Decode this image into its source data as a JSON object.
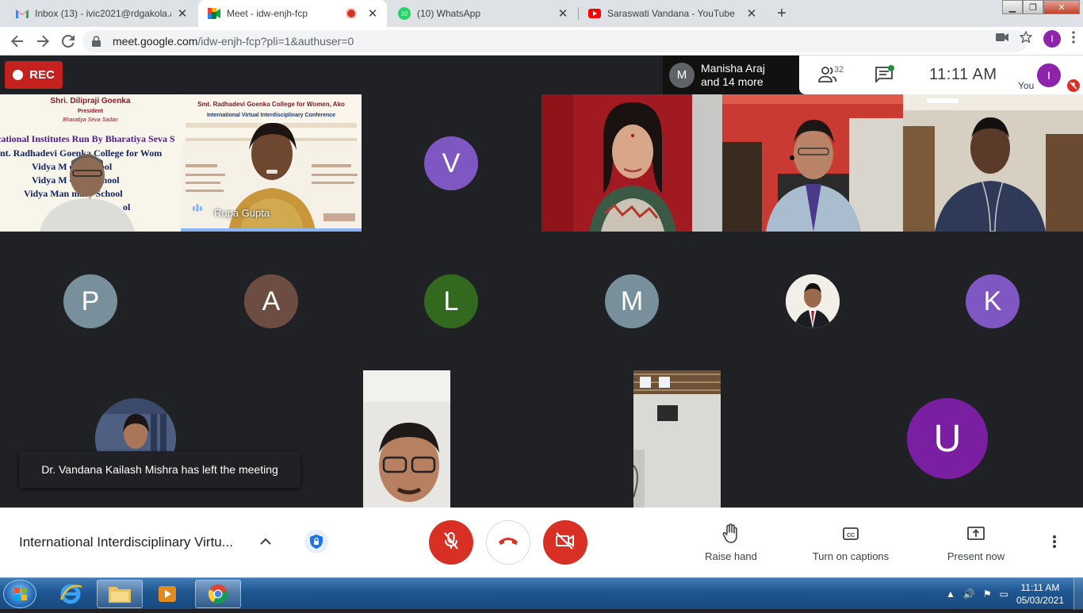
{
  "browser": {
    "tabs": [
      {
        "title": "Inbox (13) - ivic2021@rdgakola.a",
        "icon": "gmail-icon"
      },
      {
        "title": "Meet - idw-enjh-fcp",
        "icon": "meet-icon",
        "recording": true
      },
      {
        "title": "(10) WhatsApp",
        "icon": "whatsapp-icon",
        "badge": "10"
      },
      {
        "title": "Saraswati Vandana - YouTube",
        "icon": "youtube-icon"
      }
    ],
    "url_host": "meet.google.com",
    "url_path": "/idw-enjh-fcp?pli=1&authuser=0",
    "profile_initial": "I"
  },
  "meet": {
    "rec_label": "REC",
    "speaker": {
      "initial": "M",
      "line1": "Manisha Araj",
      "line2": "and 14 more"
    },
    "participants_count": "32",
    "time": "11:11  AM",
    "you_label": "You",
    "you_initial": "I",
    "tiles": {
      "rupa_name": "Rupa Gupta",
      "slide_text": {
        "line1": "Shri. Dilipraji Goenka",
        "line2": "President",
        "line3": "Bharatiya Seva Sadan",
        "line4": "cational Institutes Run By Bharatiya Seva S",
        "line5": "nt. Radhadevi Goenka College for Wom",
        "line6": "Vidya M   oys School",
        "line7": "Vidya M   Girls School",
        "line8": "Vidya Man   mary School",
        "line9": "ol",
        "banner1": "Smt. Radhadevi Goenka College for Women, Ako",
        "banner2": "International Virtual Interdisciplinary Conference"
      },
      "avatars": [
        {
          "letter": "V",
          "color": "#7e57c2"
        },
        {
          "letter": "P",
          "color": "#78909c"
        },
        {
          "letter": "A",
          "color": "#6d4c41"
        },
        {
          "letter": "L",
          "color": "#33691e"
        },
        {
          "letter": "M",
          "color": "#78909c"
        },
        {
          "letter": "K",
          "color": "#7e57c2"
        },
        {
          "letter": "U",
          "color": "#7b1fa2"
        }
      ]
    },
    "toast": "Dr. Vandana Kailash Mishra has left the meeting",
    "meeting_title": "International Interdisciplinary Virtu...",
    "actions": {
      "raise_hand": "Raise hand",
      "captions": "Turn on captions",
      "present": "Present now"
    }
  },
  "taskbar": {
    "time": "11:11 AM",
    "date": "05/03/2021"
  }
}
